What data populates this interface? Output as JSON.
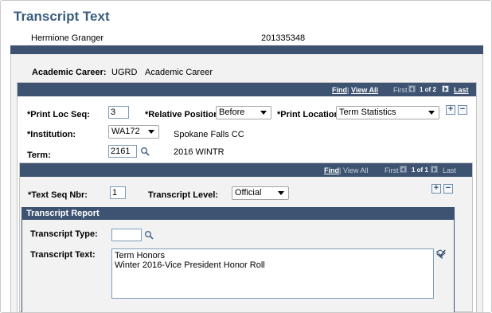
{
  "page": {
    "title": "Transcript Text"
  },
  "student": {
    "name": "Hermione Granger",
    "id": "201335348"
  },
  "career": {
    "label": "Academic Career:",
    "code": "UGRD",
    "description": "Academic Career"
  },
  "outer_nav": {
    "find": "Find",
    "view_all": "View All",
    "first": "First",
    "count": "1 of 2",
    "last": "Last"
  },
  "print_loc": {
    "seq_label": "*Print Loc Seq:",
    "seq_value": "3",
    "relpos_label": "*Relative Position:",
    "relpos_value": "Before",
    "location_label": "*Print Location:",
    "location_value": "Term Statistics"
  },
  "institution": {
    "label": "*Institution:",
    "value": "WA172",
    "description": "Spokane Falls CC"
  },
  "term": {
    "label": "Term:",
    "value": "2161",
    "description": "2016 WINTR"
  },
  "inner_nav": {
    "find": "Find",
    "view_all": "View All",
    "first": "First",
    "count": "1 of 1",
    "last": "Last"
  },
  "text_seq": {
    "label": "*Text Seq Nbr:",
    "value": "1",
    "level_label": "Transcript Level:",
    "level_value": "Official"
  },
  "report": {
    "header": "Transcript Report",
    "type_label": "Transcript Type:",
    "type_value": "",
    "text_label": "Transcript Text:",
    "text_line1": "Term Honors",
    "text_line2": "Winter 2016-Vice President Honor Roll"
  },
  "buttons": {
    "add": "+",
    "remove": "−"
  },
  "icons": {
    "lookup": "magnifier-icon",
    "spellcheck": "spellcheck-icon",
    "first": "first-arrow-icon",
    "next": "next-arrow-icon"
  }
}
